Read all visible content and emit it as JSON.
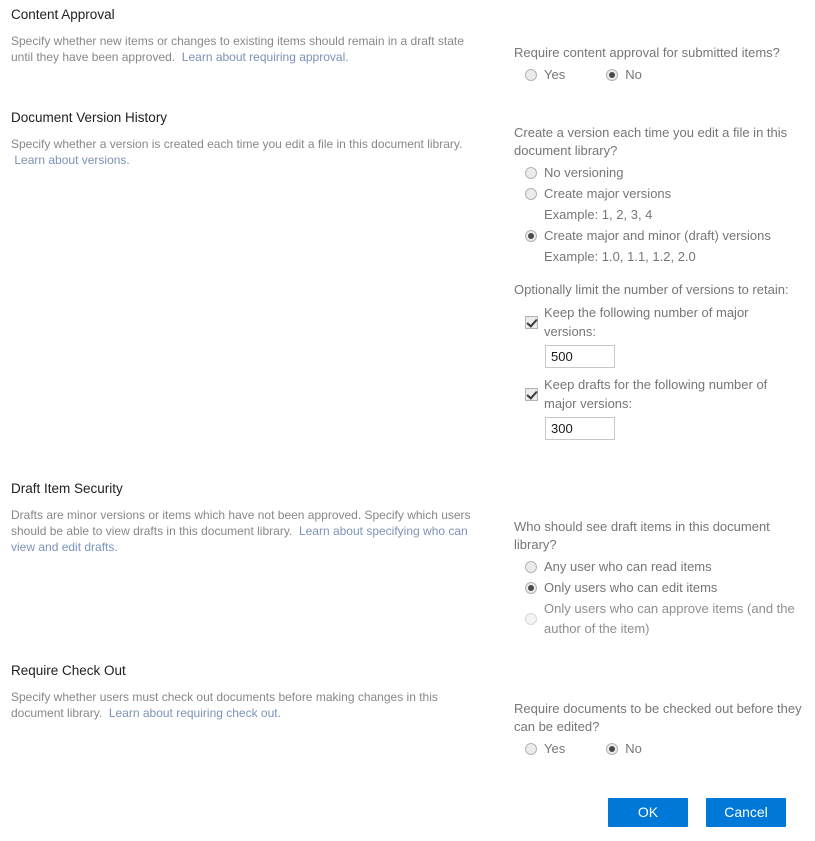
{
  "sections": {
    "content_approval": {
      "title": "Content Approval",
      "desc_text": "Specify whether new items or changes to existing items should remain in a draft state until they have been approved.",
      "desc_link": "Learn about requiring approval.",
      "question": "Require content approval for submitted items?",
      "yes_label": "Yes",
      "no_label": "No",
      "selected": "No"
    },
    "version_history": {
      "title": "Document Version History",
      "desc_text": "Specify whether a version is created each time you edit a file in this document library.",
      "desc_link": "Learn about versions.",
      "question": "Create a version each time you edit a file in this document library?",
      "options": [
        {
          "label": "No versioning",
          "example": "",
          "checked": false
        },
        {
          "label": "Create major versions",
          "example": "Example: 1, 2, 3, 4",
          "checked": false
        },
        {
          "label": "Create major and minor (draft) versions",
          "example": "Example: 1.0, 1.1, 1.2, 2.0",
          "checked": true
        }
      ],
      "limit_label": "Optionally limit the number of versions to retain:",
      "keep_major": {
        "label": "Keep the following number of major versions:",
        "checked": true,
        "value": "500"
      },
      "keep_drafts": {
        "label": "Keep drafts for the following number of major versions:",
        "checked": true,
        "value": "300"
      }
    },
    "draft_security": {
      "title": "Draft Item Security",
      "desc_text": "Drafts are minor versions or items which have not been approved. Specify which users should be able to view drafts in this document library.",
      "desc_link": "Learn about specifying who can view and edit drafts.",
      "question": "Who should see draft items in this document library?",
      "options": [
        {
          "label": "Any user who can read items",
          "checked": false,
          "dim": false
        },
        {
          "label": "Only users who can edit items",
          "checked": true,
          "dim": false
        },
        {
          "label": "Only users who can approve items (and the author of the item)",
          "checked": false,
          "dim": true
        }
      ]
    },
    "require_checkout": {
      "title": "Require Check Out",
      "desc_text": "Specify whether users must check out documents before making changes in this document library.",
      "desc_link": "Learn about requiring check out.",
      "question": "Require documents to be checked out before they can be edited?",
      "yes_label": "Yes",
      "no_label": "No",
      "selected": "No"
    }
  },
  "footer": {
    "ok_label": "OK",
    "cancel_label": "Cancel"
  },
  "colors": {
    "accent": "#0078d7",
    "link": "#7b93b8",
    "heading": "#212121",
    "body_text": "#767676"
  }
}
